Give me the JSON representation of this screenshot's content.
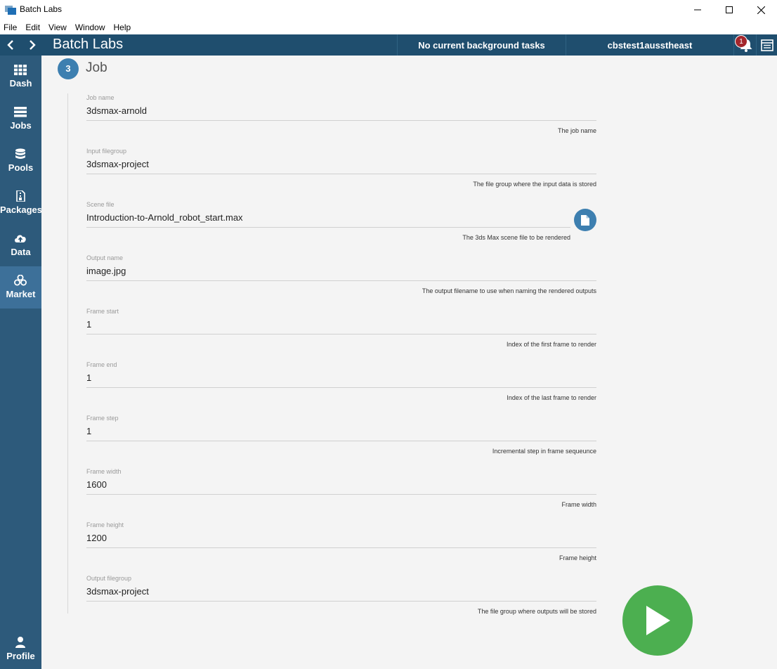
{
  "window": {
    "title": "Batch Labs",
    "controls": [
      "minimize-icon",
      "maximize-icon",
      "close-icon"
    ]
  },
  "menu": [
    "File",
    "Edit",
    "View",
    "Window",
    "Help"
  ],
  "header": {
    "brand": "Batch Labs",
    "tasks_status": "No current background tasks",
    "account": "cbstest1ausstheast",
    "notification_count": "1"
  },
  "sidebar": {
    "items": [
      {
        "label": "Dash",
        "icon": "grid-icon"
      },
      {
        "label": "Jobs",
        "icon": "list-icon"
      },
      {
        "label": "Pools",
        "icon": "database-icon"
      },
      {
        "label": "Packages",
        "icon": "package-icon"
      },
      {
        "label": "Data",
        "icon": "cloud-upload-icon"
      },
      {
        "label": "Market",
        "icon": "cubes-icon"
      }
    ],
    "active": "Market",
    "profile_label": "Profile"
  },
  "section": {
    "step": "3",
    "title": "Job"
  },
  "fields": [
    {
      "label": "Job name",
      "value": "3dsmax-arnold",
      "hint": "The job name"
    },
    {
      "label": "Input filegroup",
      "value": "3dsmax-project",
      "hint": "The file group where the input data is stored"
    },
    {
      "label": "Scene file",
      "value": "Introduction-to-Arnold_robot_start.max",
      "hint": "The 3ds Max scene file to be rendered"
    },
    {
      "label": "Output name",
      "value": "image.jpg",
      "hint": "The output filename to use when naming the rendered outputs"
    },
    {
      "label": "Frame start",
      "value": "1",
      "hint": "Index of the first frame to render"
    },
    {
      "label": "Frame end",
      "value": "1",
      "hint": "Index of the last frame to render"
    },
    {
      "label": "Frame step",
      "value": "1",
      "hint": "Incremental step in frame sequeunce"
    },
    {
      "label": "Frame width",
      "value": "1600",
      "hint": "Frame width"
    },
    {
      "label": "Frame height",
      "value": "1200",
      "hint": "Frame height"
    },
    {
      "label": "Output filegroup",
      "value": "3dsmax-project",
      "hint": "The file group where outputs will be stored"
    }
  ],
  "colors": {
    "header": "#1f4e6e",
    "sidebar": "#2d5a7b",
    "accent": "#3d7fb0",
    "run": "#4caf50",
    "badge": "#a4262c"
  }
}
